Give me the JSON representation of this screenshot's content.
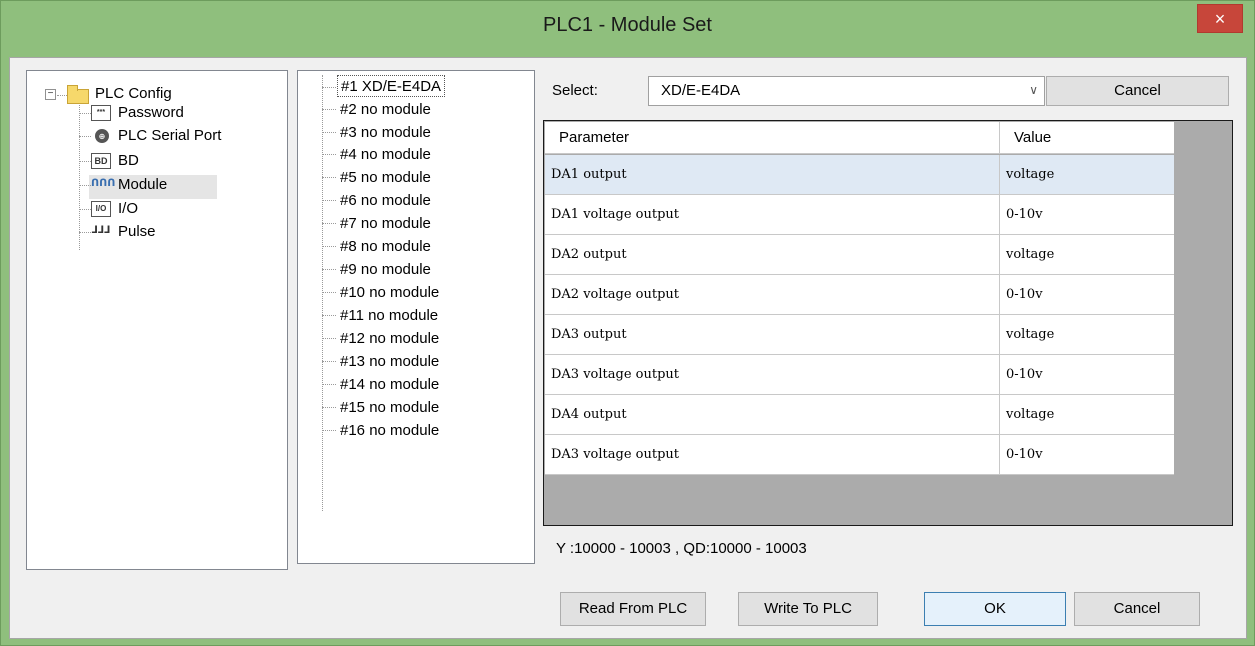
{
  "window": {
    "title": "PLC1 - Module  Set",
    "close_glyph": "×"
  },
  "tree": {
    "root": {
      "label": "PLC Config",
      "icon": "folder-icon",
      "expander": "−"
    },
    "items": [
      {
        "label": "Password",
        "icon": "password-icon",
        "glyph": "***"
      },
      {
        "label": "PLC Serial Port",
        "icon": "serial-port-icon",
        "glyph": "⊕"
      },
      {
        "label": "BD",
        "icon": "bd-icon",
        "glyph": "BD"
      },
      {
        "label": "Module",
        "icon": "module-icon",
        "glyph": "ᑎᑎᑎ"
      },
      {
        "label": "I/O",
        "icon": "io-icon",
        "glyph": "I/O"
      },
      {
        "label": "Pulse",
        "icon": "pulse-icon",
        "glyph": "ᒧᒧᒧ"
      }
    ]
  },
  "modules": [
    "#1 XD/E-E4DA",
    "#2 no module",
    "#3 no module",
    "#4 no module",
    "#5 no module",
    "#6 no module",
    "#7 no module",
    "#8 no module",
    "#9 no module",
    "#10 no module",
    "#11 no module",
    "#12 no module",
    "#13 no module",
    "#14 no module",
    "#15 no module",
    "#16 no module"
  ],
  "select": {
    "label": "Select:",
    "value": "XD/E-E4DA",
    "arrow": "∨",
    "cancel_label": "Cancel"
  },
  "grid": {
    "headers": [
      "Parameter",
      "Value"
    ],
    "rows": [
      {
        "parameter": "DA1 output",
        "value": "voltage"
      },
      {
        "parameter": "DA1 voltage output",
        "value": "0-10v"
      },
      {
        "parameter": "DA2 output",
        "value": "voltage"
      },
      {
        "parameter": "DA2 voltage output",
        "value": "0-10v"
      },
      {
        "parameter": "DA3 output",
        "value": "voltage"
      },
      {
        "parameter": "DA3 voltage output",
        "value": "0-10v"
      },
      {
        "parameter": "DA4 output",
        "value": "voltage"
      },
      {
        "parameter": "DA3 voltage output",
        "value": "0-10v"
      }
    ]
  },
  "address_info": "Y :10000 - 10003 , QD:10000 - 10003",
  "buttons": {
    "read": "Read From PLC",
    "write": "Write To PLC",
    "ok": "OK",
    "cancel": "Cancel"
  },
  "colors": {
    "title_bar": "#8fbf7d",
    "close_button": "#c7463a",
    "selected_row": "#dfe9f4",
    "grid_background": "#ababab"
  }
}
